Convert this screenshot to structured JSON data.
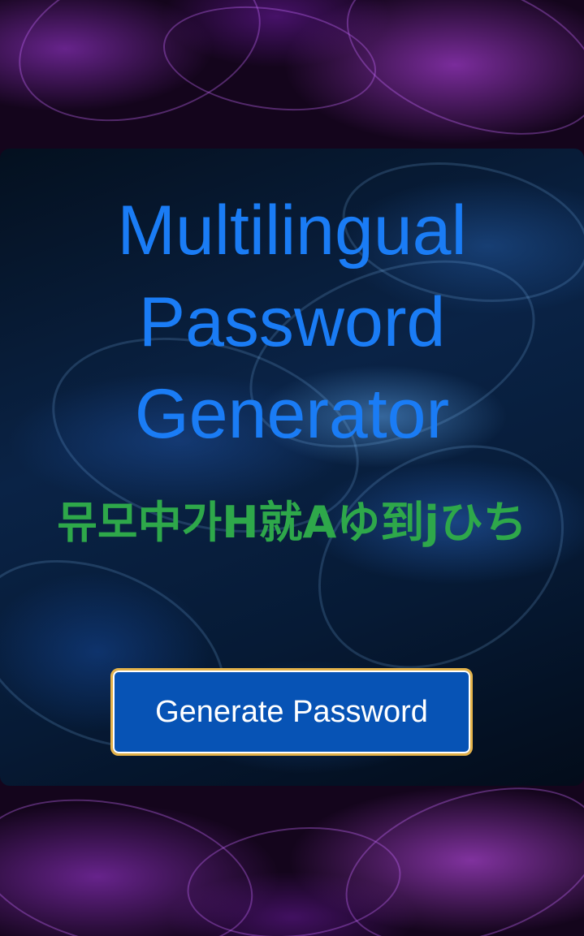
{
  "app": {
    "title": "Multilingual Password Generator"
  },
  "password": {
    "value": "뮤모中가H就Aゆ到jひち"
  },
  "actions": {
    "generate_label": "Generate Password"
  },
  "colors": {
    "title": "#1a7cf5",
    "password": "#2ea84a",
    "button_bg": "#0753b5",
    "button_border": "#e3b24a",
    "button_text": "#ffffff"
  }
}
